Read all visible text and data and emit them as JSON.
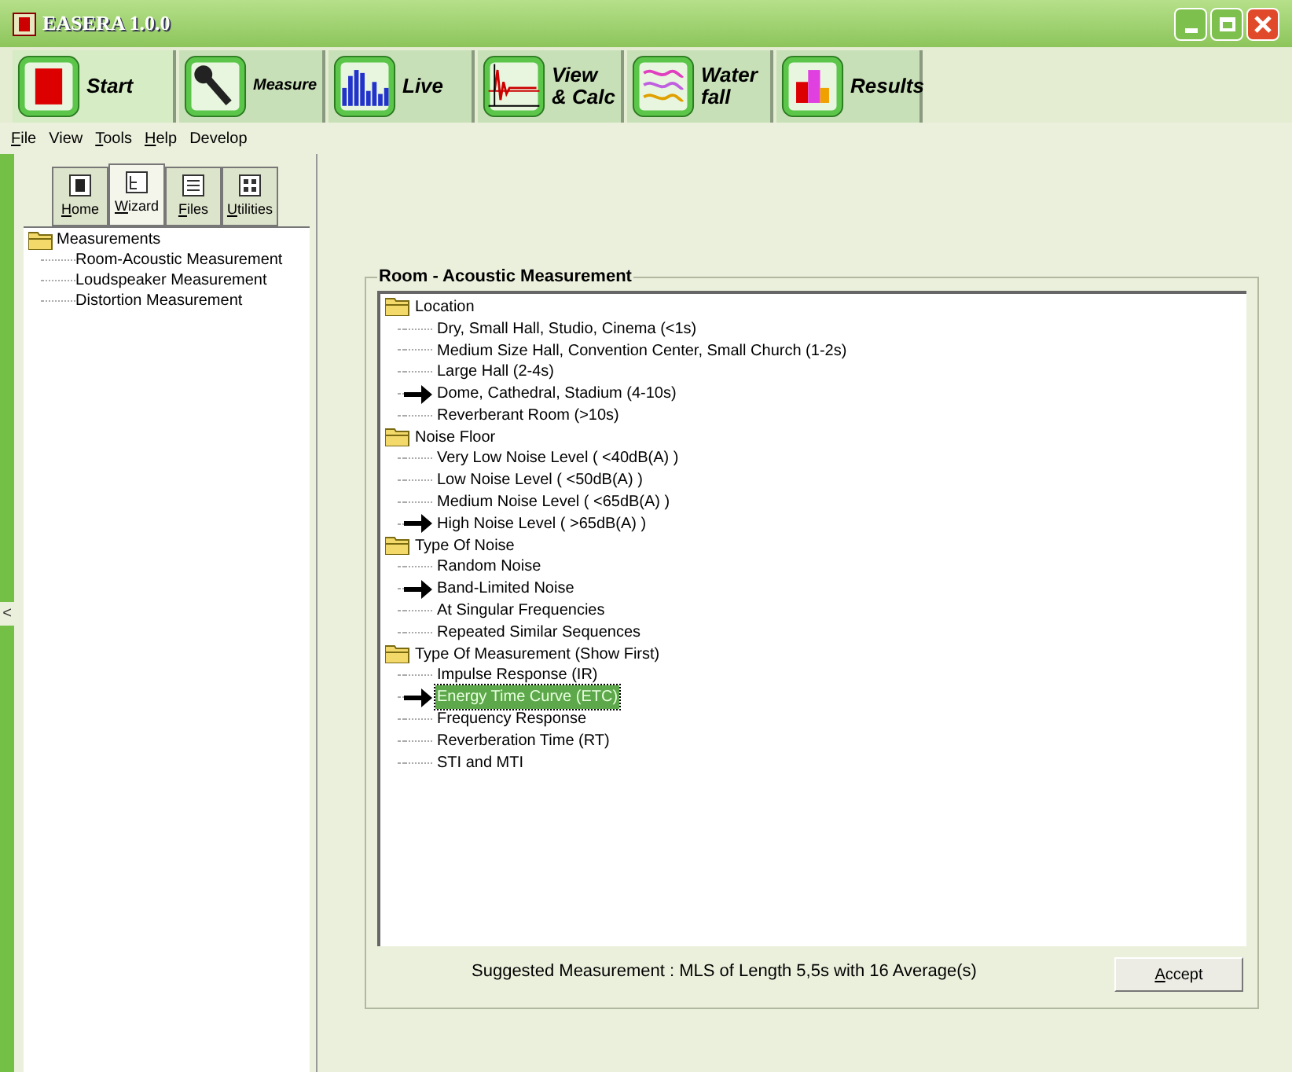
{
  "window": {
    "title": "EASERA 1.0.0"
  },
  "toolbar": [
    {
      "kind": "start",
      "label": "Start",
      "selected": true
    },
    {
      "kind": "measure",
      "label": "Measure",
      "selected": false
    },
    {
      "kind": "live",
      "label": "Live",
      "selected": false
    },
    {
      "kind": "view",
      "label": "View & Calc",
      "selected": false
    },
    {
      "kind": "waterfall",
      "label": "Water fall",
      "selected": false
    },
    {
      "kind": "results",
      "label": "Results",
      "selected": false
    }
  ],
  "menu": [
    {
      "label": "File",
      "underline_first": true
    },
    {
      "label": "View",
      "underline_first": false
    },
    {
      "label": "Tools",
      "underline_first": true
    },
    {
      "label": "Help",
      "underline_first": true
    },
    {
      "label": "Develop",
      "underline_first": false
    }
  ],
  "sidebar": {
    "tabs": [
      {
        "kind": "home",
        "label": "Home",
        "selected": false
      },
      {
        "kind": "wizard",
        "label": "Wizard",
        "selected": true
      },
      {
        "kind": "files",
        "label": "Files",
        "selected": false
      },
      {
        "kind": "utilities",
        "label": "Utilities",
        "selected": false
      }
    ],
    "tree": {
      "label": "Measurements",
      "children": [
        {
          "label": "Room-Acoustic Measurement"
        },
        {
          "label": "Loudspeaker Measurement"
        },
        {
          "label": "Distortion Measurement"
        }
      ]
    },
    "collapse": "<"
  },
  "wizard": {
    "title": "Room - Acoustic Measurement",
    "groups": [
      {
        "label": "Location",
        "children": [
          {
            "label": "Dry, Small Hall, Studio, Cinema (<1s)",
            "chosen": false,
            "selected": false
          },
          {
            "label": "Medium Size Hall, Convention Center, Small Church (1-2s)",
            "chosen": false,
            "selected": false
          },
          {
            "label": "Large Hall (2-4s)",
            "chosen": false,
            "selected": false
          },
          {
            "label": "Dome, Cathedral, Stadium (4-10s)",
            "chosen": true,
            "selected": false
          },
          {
            "label": "Reverberant Room (>10s)",
            "chosen": false,
            "selected": false
          }
        ]
      },
      {
        "label": "Noise Floor",
        "children": [
          {
            "label": "Very Low Noise Level ( <40dB(A) )",
            "chosen": false,
            "selected": false
          },
          {
            "label": "Low Noise Level ( <50dB(A) )",
            "chosen": false,
            "selected": false
          },
          {
            "label": "Medium Noise Level ( <65dB(A) )",
            "chosen": false,
            "selected": false
          },
          {
            "label": "High Noise Level ( >65dB(A) )",
            "chosen": true,
            "selected": false
          }
        ]
      },
      {
        "label": "Type Of Noise",
        "children": [
          {
            "label": "Random Noise",
            "chosen": false,
            "selected": false
          },
          {
            "label": "Band-Limited Noise",
            "chosen": true,
            "selected": false
          },
          {
            "label": "At Singular Frequencies",
            "chosen": false,
            "selected": false
          },
          {
            "label": "Repeated Similar Sequences",
            "chosen": false,
            "selected": false
          }
        ]
      },
      {
        "label": "Type Of Measurement (Show First)",
        "children": [
          {
            "label": "Impulse Response (IR)",
            "chosen": false,
            "selected": false
          },
          {
            "label": "Energy Time Curve (ETC)",
            "chosen": true,
            "selected": true
          },
          {
            "label": "Frequency Response",
            "chosen": false,
            "selected": false
          },
          {
            "label": "Reverberation Time (RT)",
            "chosen": false,
            "selected": false
          },
          {
            "label": "STI and MTI",
            "chosen": false,
            "selected": false
          }
        ]
      }
    ],
    "suggestion": "Suggested Measurement : MLS of Length 5,5s with 16 Average(s)",
    "accept": "Accept"
  }
}
